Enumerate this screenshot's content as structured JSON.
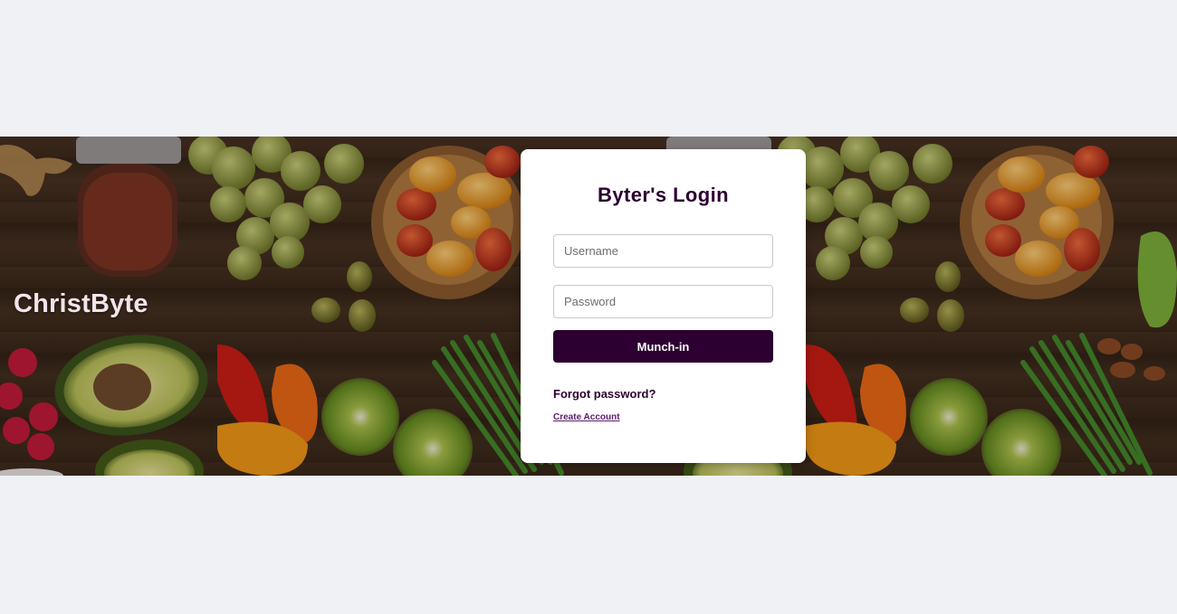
{
  "brand": {
    "name": "ChristByte"
  },
  "login": {
    "title": "Byter's Login",
    "username_placeholder": "Username",
    "password_placeholder": "Password",
    "submit_label": "Munch-in",
    "forgot_label": "Forgot password?",
    "create_label": "Create Account"
  },
  "colors": {
    "primary": "#2c0030",
    "page_background": "#f0f1f5",
    "card_background": "#ffffff",
    "link": "#5a1c6e"
  },
  "hero": {
    "image": "fresh-produce-on-wooden-table"
  }
}
